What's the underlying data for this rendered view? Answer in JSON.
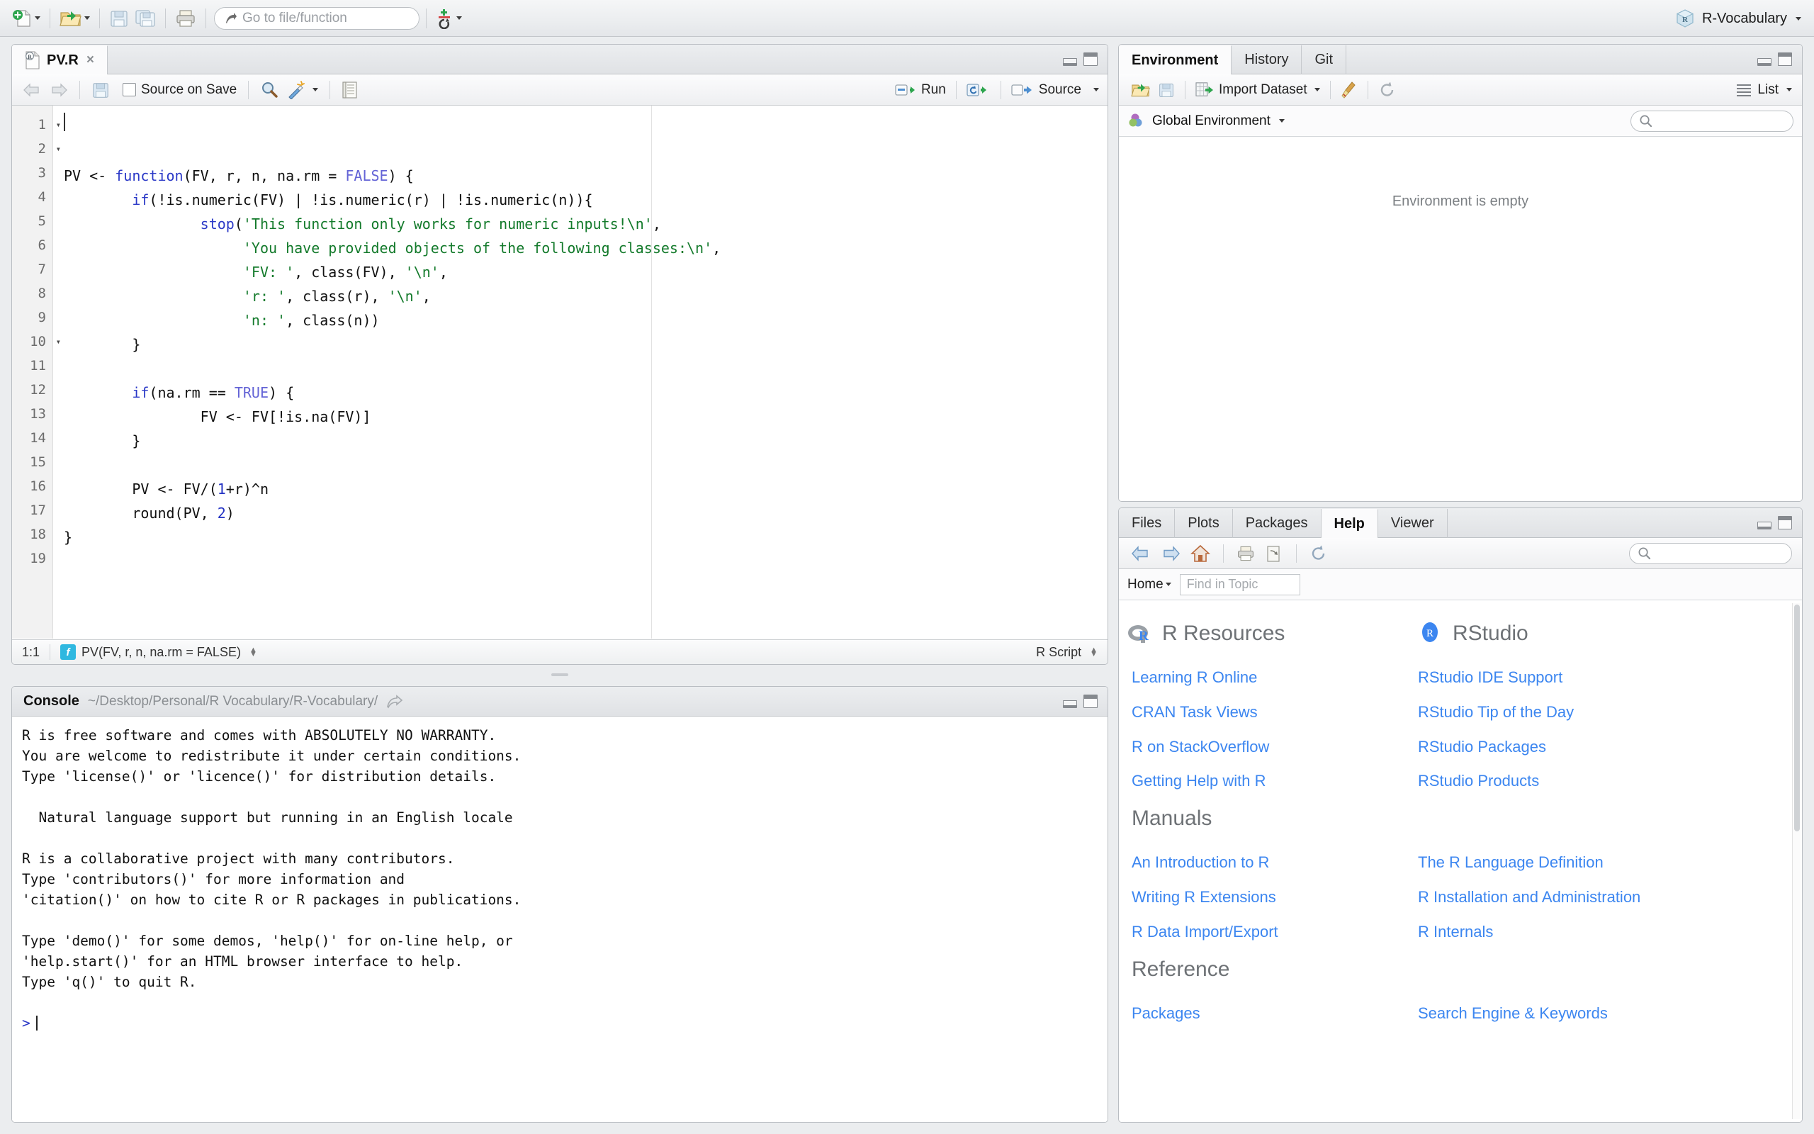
{
  "toolbar": {
    "new_file_label": "new-file",
    "open_file_label": "open-file",
    "save_label": "save",
    "save_all_label": "save-all",
    "print_label": "print",
    "goto_placeholder": "Go to file/function",
    "addins_label": "addins",
    "project_name": "R-Vocabulary"
  },
  "source": {
    "tab_label": "PV.R",
    "tab_close": "×",
    "back_label": "back",
    "forward_label": "forward",
    "save_label": "save",
    "source_on_save_label": "Source on Save",
    "source_on_save_checked": false,
    "find_label": "find",
    "wand_label": "code-tools",
    "compile_label": "compile-report",
    "run_label": "Run",
    "rerun_label": "re-run",
    "source_label": "Source",
    "lines": [
      {
        "n": "1",
        "fold": true,
        "html": "PV <- <span class=\"k\">function</span>(FV, r, n, na.rm = <span class=\"c\">FALSE</span>) {"
      },
      {
        "n": "2",
        "fold": true,
        "html": "        <span class=\"k\">if</span>(!is.numeric(FV) | !is.numeric(r) | !is.numeric(n)){"
      },
      {
        "n": "3",
        "fold": false,
        "html": "                <span class=\"f\">stop</span>(<span class=\"s\">'This function only works for numeric inputs!\\n'</span>,"
      },
      {
        "n": "4",
        "fold": false,
        "html": "                     <span class=\"s\">'You have provided objects of the following classes:\\n'</span>,"
      },
      {
        "n": "5",
        "fold": false,
        "html": "                     <span class=\"s\">'FV: '</span>, class(FV), <span class=\"s\">'\\n'</span>,"
      },
      {
        "n": "6",
        "fold": false,
        "html": "                     <span class=\"s\">'r: '</span>, class(r), <span class=\"s\">'\\n'</span>,"
      },
      {
        "n": "7",
        "fold": false,
        "html": "                     <span class=\"s\">'n: '</span>, class(n))"
      },
      {
        "n": "8",
        "fold": false,
        "html": "        }"
      },
      {
        "n": "9",
        "fold": false,
        "html": ""
      },
      {
        "n": "10",
        "fold": true,
        "html": "        <span class=\"k\">if</span>(na.rm == <span class=\"c\">TRUE</span>) {"
      },
      {
        "n": "11",
        "fold": false,
        "html": "                FV <- FV[!is.na(FV)]"
      },
      {
        "n": "12",
        "fold": false,
        "html": "        }"
      },
      {
        "n": "13",
        "fold": false,
        "html": ""
      },
      {
        "n": "14",
        "fold": false,
        "html": "        PV <- FV/(<span class=\"n\">1</span>+r)^n"
      },
      {
        "n": "15",
        "fold": false,
        "html": "        round(PV, <span class=\"n\">2</span>)"
      },
      {
        "n": "16",
        "fold": false,
        "html": "}"
      },
      {
        "n": "17",
        "fold": false,
        "html": ""
      },
      {
        "n": "18",
        "fold": false,
        "html": ""
      },
      {
        "n": "19",
        "fold": false,
        "html": ""
      }
    ],
    "status": {
      "cursor_position": "1:1",
      "scope": "PV(FV, r, n, na.rm = FALSE)",
      "file_type": "R Script"
    }
  },
  "console": {
    "title": "Console",
    "path": "~/Desktop/Personal/R Vocabulary/R-Vocabulary/",
    "lines": [
      "R is free software and comes with ABSOLUTELY NO WARRANTY.",
      "You are welcome to redistribute it under certain conditions.",
      "Type 'license()' or 'licence()' for distribution details.",
      "",
      "  Natural language support but running in an English locale",
      "",
      "R is a collaborative project with many contributors.",
      "Type 'contributors()' for more information and",
      "'citation()' on how to cite R or R packages in publications.",
      "",
      "Type 'demo()' for some demos, 'help()' for on-line help, or",
      "'help.start()' for an HTML browser interface to help.",
      "Type 'q()' to quit R.",
      ""
    ],
    "prompt": ">"
  },
  "environment": {
    "tabs": [
      {
        "label": "Environment",
        "active": true
      },
      {
        "label": "History",
        "active": false
      },
      {
        "label": "Git",
        "active": false
      }
    ],
    "load_label": "load-workspace",
    "save_label": "save-workspace",
    "import_dataset_label": "Import Dataset",
    "clear_label": "clear-objects",
    "refresh_label": "refresh",
    "view_mode_label": "List",
    "scope_label": "Global Environment",
    "search_placeholder": "",
    "empty_message": "Environment is empty"
  },
  "help": {
    "tabs": [
      {
        "label": "Files",
        "active": false
      },
      {
        "label": "Plots",
        "active": false
      },
      {
        "label": "Packages",
        "active": false
      },
      {
        "label": "Help",
        "active": true
      },
      {
        "label": "Viewer",
        "active": false
      }
    ],
    "back_label": "back",
    "forward_label": "forward",
    "home_label": "home",
    "print_label": "print",
    "popout_label": "show-in-new-window",
    "refresh_label": "refresh",
    "search_placeholder": "",
    "home_dropdown_label": "Home",
    "find_in_topic_placeholder": "Find in Topic",
    "sections": [
      {
        "heading_left": "R Resources",
        "icon_left": "r-logo-grey-icon",
        "heading_right": "RStudio",
        "icon_right": "rstudio-logo-icon",
        "links_left": [
          "Learning R Online",
          "CRAN Task Views",
          "R on StackOverflow",
          "Getting Help with R"
        ],
        "links_right": [
          "RStudio IDE Support",
          "RStudio Tip of the Day",
          "RStudio Packages",
          "RStudio Products"
        ]
      },
      {
        "heading_left": "Manuals",
        "heading_right": "",
        "links_left": [
          "An Introduction to R",
          "Writing R Extensions",
          "R Data Import/Export"
        ],
        "links_right": [
          "The R Language Definition",
          "R Installation and Administration",
          "R Internals"
        ]
      },
      {
        "heading_left": "Reference",
        "heading_right": "",
        "links_left": [
          "Packages"
        ],
        "links_right": [
          "Search Engine & Keywords"
        ]
      }
    ]
  },
  "colors": {
    "accent_blue": "#3c86f0",
    "keyword": "#2b39c7",
    "string": "#137a2b",
    "prompt": "#2b39c7",
    "chrome": "#ebedef"
  }
}
